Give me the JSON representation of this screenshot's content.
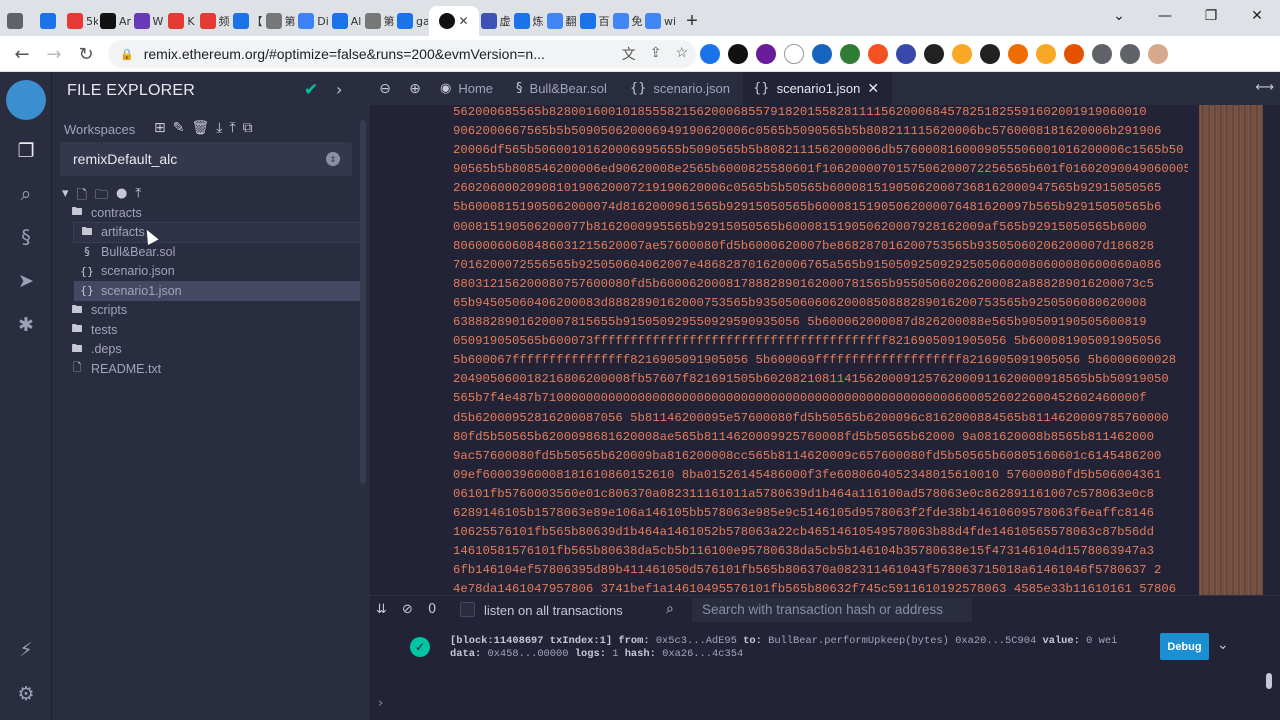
{
  "browser": {
    "tabs": [
      {
        "label": "",
        "favicon_color": "#5f6368"
      },
      {
        "label": "",
        "favicon_color": "#1a73e8"
      },
      {
        "label": "5k+",
        "favicon_color": "#e53935"
      },
      {
        "label": "Ar",
        "favicon_color": "#111111"
      },
      {
        "label": "W",
        "favicon_color": "#673ab7"
      },
      {
        "label": "K",
        "favicon_color": "#e53935"
      },
      {
        "label": "频",
        "favicon_color": "#e53935"
      },
      {
        "label": "【",
        "favicon_color": "#1a73e8"
      },
      {
        "label": "第",
        "favicon_color": "#777777"
      },
      {
        "label": "Di",
        "favicon_color": "#3b82f6"
      },
      {
        "label": "Al",
        "favicon_color": "#1a73e8"
      },
      {
        "label": "第",
        "favicon_color": "#777777"
      },
      {
        "label": "ga",
        "favicon_color": "#1a73e8"
      }
    ],
    "active_tab_close": "✕",
    "tabs_after": [
      {
        "label": "虚",
        "favicon_color": "#3f51b5"
      },
      {
        "label": "炼",
        "favicon_color": "#1a73e8"
      },
      {
        "label": "翻",
        "favicon_color": "#4285f4"
      },
      {
        "label": "百",
        "favicon_color": "#1a73e8"
      },
      {
        "label": "免",
        "favicon_color": "#4285f4"
      },
      {
        "label": "wi",
        "favicon_color": "#4285f4"
      }
    ],
    "new_tab": "+",
    "window_controls": [
      "⌄",
      "—",
      "❐",
      "✕"
    ],
    "url": "remix.ethereum.org/#optimize=false&runs=200&evmVersion=n...",
    "extension_colors": [
      "#1a73e8",
      "#111111",
      "#6a1b9a",
      "#ffffff",
      "#1565c0",
      "#2e7d32",
      "#f4511e",
      "#3949ab",
      "#212121",
      "#f9a825",
      "#212121",
      "#ef6c00",
      "#f9a825",
      "#e65100",
      "#5f6368",
      "#5f6368",
      "#d7a98c"
    ]
  },
  "icon_panel": {
    "icons": [
      "file-explorer-icon",
      "search-icon",
      "solidity-compiler-icon",
      "deploy-icon",
      "debugger-icon",
      "plugin-manager-icon",
      "settings-icon"
    ]
  },
  "file_explorer": {
    "title": "FILE EXPLORER",
    "workspaces_label": "Workspaces",
    "workspace_name": "remixDefault_alc",
    "tree": [
      {
        "label": "contracts",
        "type": "folder",
        "level": 0
      },
      {
        "label": "artifacts",
        "type": "folder",
        "level": 1,
        "state": "hover"
      },
      {
        "label": "Bull&Bear.sol",
        "type": "sol",
        "level": 1
      },
      {
        "label": "scenario.json",
        "type": "json",
        "level": 1
      },
      {
        "label": "scenario1.json",
        "type": "json",
        "level": 1,
        "state": "selected"
      },
      {
        "label": "scripts",
        "type": "folder",
        "level": 0
      },
      {
        "label": "tests",
        "type": "folder",
        "level": 0
      },
      {
        "label": ".deps",
        "type": "folder",
        "level": 0
      },
      {
        "label": "README.txt",
        "type": "file",
        "level": 0
      }
    ]
  },
  "editor": {
    "tabs": [
      {
        "label": "Home",
        "icon": "remix-icon"
      },
      {
        "label": "Bull&Bear.sol",
        "icon": "solidity-icon"
      },
      {
        "label": "scenario.json",
        "icon": "json-icon"
      },
      {
        "label": "scenario1.json",
        "icon": "json-icon",
        "active": true
      }
    ],
    "code_lines": [
      "562000685565b828001600101855582156200068557918201558281111562000684578251825591602001919060010",
      "9062000667565b5b509050620006949190620006c0565b5090565b5b808211115620006bc5760008181620006b291906",
      "20006df565b50600101620006995655b5090565b5b8082111562000006db5760008160009055506001016200006c1565b50",
      "90565b5b808546200006ed90620008e2565b6000825580601f1062000070157506200072256565b601f01602090049060005",
      "2602060002090810190620007219190620006c0565b5b50565b600081519050620007368162000947565b92915050565",
      "5b60008151905062000074d8162000961565b92915050565b60008151905062000076481620097b565b92915050565b6",
      "000815190506200077b8162000995565b92915050565b600081519050620007928162009af565b92915050565b6000",
      "80600060608486031215620007ae57600080fd5b6000620007be868287016200753565b93505060206200007d186828",
      "7016200072556565b925050604062007e486828701620006765a565b915050925092925050600080600080600060a086",
      "880312156200080757600080fd5b6000620008178882890162000781565b95505060206200082a888289016200073c5",
      "65b94505060406200083d8882890162000753565b935050606062000850888289016200753565b9250506080620008",
      "6388828901620007815655b915050929550929590935056 5b600062000087d826200088e565b90509190505600819",
      "050919050565b600073ffffffffffffffffffffffffffffffffffffffff8216905091905056 5b600081905091905056",
      "5b600067ffffffffffffffff8216905091905056 5b600069ffffffffffffffffffff8216905091905056 5b6000600028",
      "204905060018216806200008fb57607f821691505b60208210811415620009125762000911620000918565b5b50919050",
      "565b7f4e487b710000000000000000000000000000000000000000000000000000006000526022600452602460000f",
      "d5b62000952816200087056 5b81146200095e57600080fd5b50565b6200096c8162000884565b8114620009785760000",
      "80fd5b50565b6200098681620008ae565b8114620009925760008fd5b50565b62000 9a081620008b8565b811462000",
      "9ac57600080fd5b50565b620009ba816200008cc565b8114620009c657600080fd5b50565b60805160601c6145486200",
      "09ef60003960008181610860152610 8ba01526145486000f3fe6080604052348015610010 57600080fd5b506004361",
      "06101fb5760003560e01c806370a082311161011a5780639d1b464a116100ad578063e0c862891161007c578063e0c8",
      "6289146105b1578063e89e106a146105bb578063e985e9c5146105d9578063f2fde38b14610609578063f6eaffc8146",
      "10625576101fb565b80639d1b464a1461052b578063a22cb46514610549578063b88d4fde14610565578063c87b56dd",
      "14610581576101fb565b80638da5cb5b116100e95780638da5cb5b146104b35780638e15f473146104d1578063947a3",
      "6fb146104ef57806395d89b411461050d576101fb565b806370a082311461043f578063715018a61461046f5780637 2",
      "4e78da1461047957806 3741bef1a14610495576101fb565b80632f745c5911610192578063 4585e33b11610161 57806"
    ]
  },
  "terminal": {
    "tx_count": "0",
    "listen_label": "listen on all transactions",
    "search_placeholder": "Search with transaction hash or address",
    "tx": {
      "line1_prefix": "[block:11408697 txIndex:1]",
      "from_label": "from:",
      "from": "0x5c3...AdE95",
      "to_label": "to:",
      "to": "BullBear.performUpkeep(bytes) 0xa20...5C904",
      "value_label": "value:",
      "value": "0 wei",
      "data_label": "data:",
      "data": "0x458...00000",
      "logs_label": "logs:",
      "logs": "1",
      "hash_label": "hash:",
      "hash": "0xa26...4c354"
    },
    "debug_label": "Debug"
  }
}
